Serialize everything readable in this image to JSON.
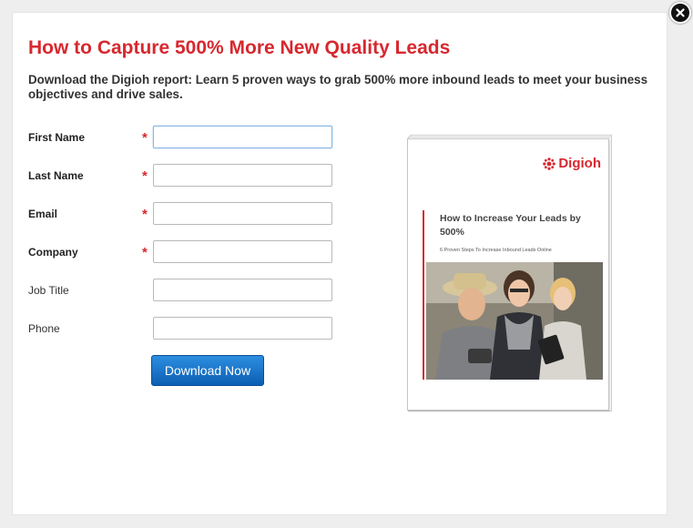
{
  "modal": {
    "title": "How to Capture 500% More New Quality Leads",
    "subtitle": "Download the Digioh report: Learn 5 proven ways to grab 500% more inbound leads to meet your business objectives and drive sales."
  },
  "close_icon": "close-icon",
  "form": {
    "fields": [
      {
        "label": "First Name",
        "required": true,
        "value": "",
        "placeholder": ""
      },
      {
        "label": "Last Name",
        "required": true,
        "value": "",
        "placeholder": ""
      },
      {
        "label": "Email",
        "required": true,
        "value": "",
        "placeholder": ""
      },
      {
        "label": "Company",
        "required": true,
        "value": "",
        "placeholder": ""
      },
      {
        "label": "Job Title",
        "required": false,
        "value": "",
        "placeholder": ""
      },
      {
        "label": "Phone",
        "required": false,
        "value": "",
        "placeholder": ""
      }
    ],
    "required_marker": "*",
    "submit_label": "Download Now"
  },
  "report": {
    "brand": "Digioh",
    "title": "How to Increase Your Leads by 500%",
    "subtitle": "6 Proven Steps To Increase Inbound Leads Online"
  },
  "colors": {
    "accent_red": "#d7282f",
    "button_blue": "#1a73c9"
  }
}
